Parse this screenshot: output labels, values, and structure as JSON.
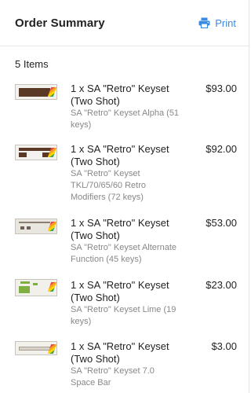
{
  "header": {
    "title": "Order Summary",
    "print_label": "Print",
    "print_icon": "printer-icon",
    "accent": "#3a8be0"
  },
  "summary": {
    "item_count": "5 Items"
  },
  "items": [
    {
      "title": "1 x SA \"Retro\" Keyset (Two Shot)",
      "subtitle": "SA \"Retro\" Keyset Alpha (51 keys)",
      "price": "$93.00"
    },
    {
      "title": "1 x SA \"Retro\" Keyset (Two Shot)",
      "subtitle": "SA \"Retro\" Keyset TKL/70/65/60 Retro Modifiers (72 keys)",
      "price": "$92.00"
    },
    {
      "title": "1 x SA \"Retro\" Keyset (Two Shot)",
      "subtitle": "SA \"Retro\" Keyset Alternate Function (45 keys)",
      "price": "$53.00"
    },
    {
      "title": "1 x SA \"Retro\" Keyset (Two Shot)",
      "subtitle": "SA \"Retro\" Keyset Lime (19 keys)",
      "price": "$23.00"
    },
    {
      "title": "1 x SA \"Retro\" Keyset (Two Shot)",
      "subtitle": "SA \"Retro\" Keyset 7.0 Space Bar",
      "price": "$3.00"
    }
  ]
}
